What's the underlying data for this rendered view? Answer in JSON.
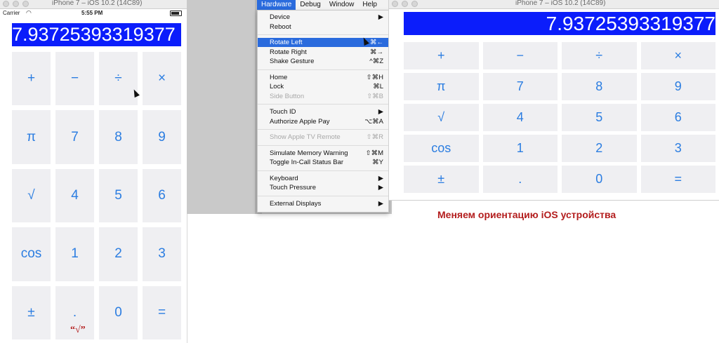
{
  "left_window": {
    "title": "iPhone 7 – iOS 10.2 (14C89)",
    "status": {
      "carrier": "Carrier",
      "time": "5:55 PM"
    },
    "display": "7.93725393319377",
    "keys": [
      "+",
      "−",
      "÷",
      "×",
      "π",
      "7",
      "8",
      "9",
      "√",
      "4",
      "5",
      "6",
      "cos",
      "1",
      "2",
      "3",
      "±",
      ".",
      "0",
      "="
    ],
    "annotation": "“√”"
  },
  "menubar": {
    "items": [
      "Hardware",
      "Debug",
      "Window",
      "Help"
    ],
    "active": "Hardware"
  },
  "hardware_menu": {
    "groups": [
      [
        {
          "label": "Device",
          "shortcut": "▶",
          "disabled": false
        },
        {
          "label": "Reboot",
          "shortcut": "",
          "disabled": false
        }
      ],
      [
        {
          "label": "Rotate Left",
          "shortcut": "⌘←",
          "disabled": false,
          "highlighted": true
        },
        {
          "label": "Rotate Right",
          "shortcut": "⌘→",
          "disabled": false
        },
        {
          "label": "Shake Gesture",
          "shortcut": "^⌘Z",
          "disabled": false
        }
      ],
      [
        {
          "label": "Home",
          "shortcut": "⇧⌘H",
          "disabled": false
        },
        {
          "label": "Lock",
          "shortcut": "⌘L",
          "disabled": false
        },
        {
          "label": "Side Button",
          "shortcut": "⇧⌘B",
          "disabled": true
        }
      ],
      [
        {
          "label": "Touch ID",
          "shortcut": "▶",
          "disabled": false
        },
        {
          "label": "Authorize Apple Pay",
          "shortcut": "⌥⌘A",
          "disabled": false
        }
      ],
      [
        {
          "label": "Show Apple TV Remote",
          "shortcut": "⇧⌘R",
          "disabled": true
        }
      ],
      [
        {
          "label": "Simulate Memory Warning",
          "shortcut": "⇧⌘M",
          "disabled": false
        },
        {
          "label": "Toggle In-Call Status Bar",
          "shortcut": "⌘Y",
          "disabled": false
        }
      ],
      [
        {
          "label": "Keyboard",
          "shortcut": "▶",
          "disabled": false
        },
        {
          "label": "Touch Pressure",
          "shortcut": "▶",
          "disabled": false
        }
      ],
      [
        {
          "label": "External Displays",
          "shortcut": "▶",
          "disabled": false
        }
      ]
    ]
  },
  "right_window": {
    "title": "iPhone 7 – iOS 10.2 (14C89)",
    "display": "7.93725393319377",
    "keys": [
      "+",
      "−",
      "÷",
      "×",
      "π",
      "7",
      "8",
      "9",
      "√",
      "4",
      "5",
      "6",
      "cos",
      "1",
      "2",
      "3",
      "±",
      ".",
      "0",
      "="
    ]
  },
  "caption": "Меняем ориентацию iOS устройства",
  "colors": {
    "display_bg": "#0b1dfb",
    "key_text": "#2b7de1",
    "key_bg": "#efeff2",
    "caption": "#b31d1d",
    "menu_highlight": "#2a6bdd"
  }
}
